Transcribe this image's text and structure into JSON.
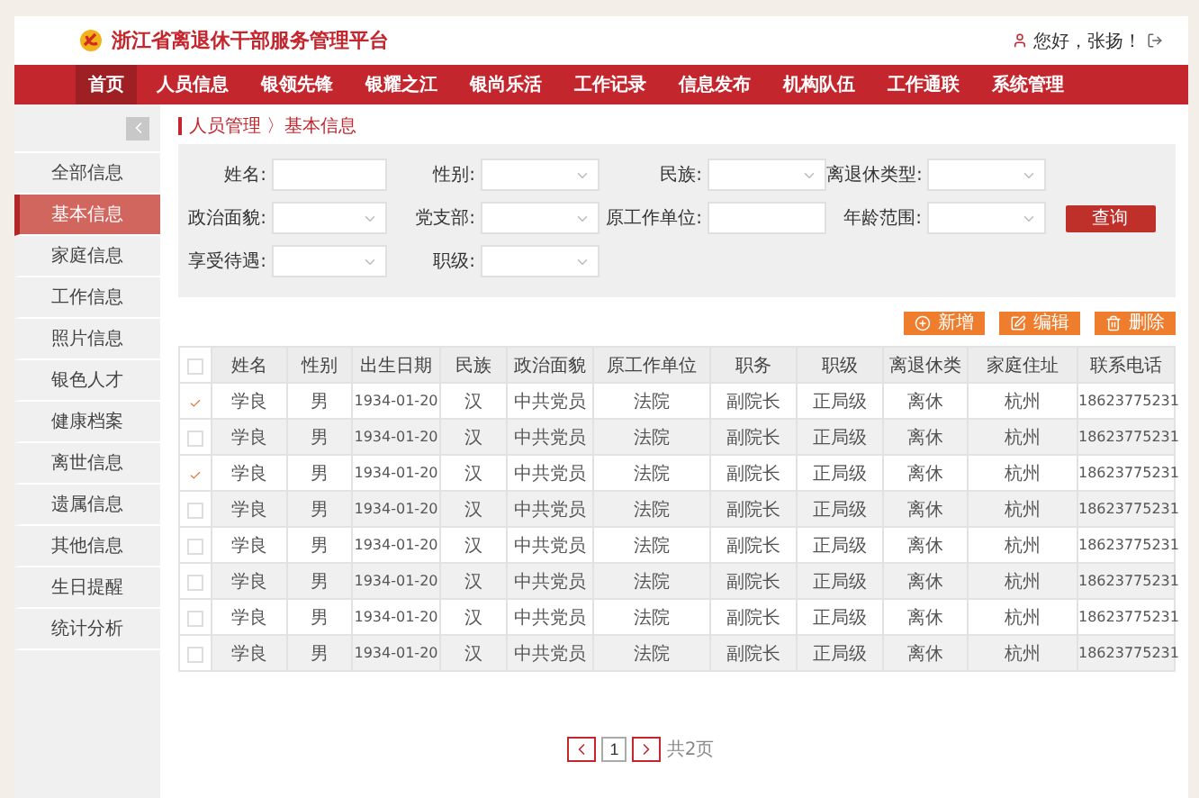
{
  "header": {
    "title": "浙江省离退休干部服务管理平台",
    "greeting": "您好，张扬！"
  },
  "nav": [
    {
      "label": "首页",
      "selected": true
    },
    {
      "label": "人员信息",
      "selected": false
    },
    {
      "label": "银领先锋",
      "selected": false
    },
    {
      "label": "银耀之江",
      "selected": false
    },
    {
      "label": "银尚乐活",
      "selected": false
    },
    {
      "label": "工作记录",
      "selected": false
    },
    {
      "label": "信息发布",
      "selected": false
    },
    {
      "label": "机构队伍",
      "selected": false
    },
    {
      "label": "工作通联",
      "selected": false
    },
    {
      "label": "系统管理",
      "selected": false
    }
  ],
  "sidebar": {
    "items": [
      {
        "label": "全部信息",
        "selected": false
      },
      {
        "label": "基本信息",
        "selected": true
      },
      {
        "label": "家庭信息",
        "selected": false
      },
      {
        "label": "工作信息",
        "selected": false
      },
      {
        "label": "照片信息",
        "selected": false
      },
      {
        "label": "银色人才",
        "selected": false
      },
      {
        "label": "健康档案",
        "selected": false
      },
      {
        "label": "离世信息",
        "selected": false
      },
      {
        "label": "遗属信息",
        "selected": false
      },
      {
        "label": "其他信息",
        "selected": false
      },
      {
        "label": "生日提醒",
        "selected": false
      },
      {
        "label": "统计分析",
        "selected": false
      }
    ]
  },
  "breadcrumb": "人员管理 〉基本信息",
  "filters": [
    {
      "label": "姓名:",
      "kind": "input"
    },
    {
      "label": "性别:",
      "kind": "select"
    },
    {
      "label": "民族:",
      "kind": "select"
    },
    {
      "label": "离退休类型:",
      "kind": "select"
    },
    {
      "label": "政治面貌:",
      "kind": "select"
    },
    {
      "label": "党支部:",
      "kind": "select"
    },
    {
      "label": "原工作单位:",
      "kind": "input"
    },
    {
      "label": "年龄范围:",
      "kind": "select"
    },
    {
      "label": "享受待遇:",
      "kind": "select"
    },
    {
      "label": "职级:",
      "kind": "select"
    }
  ],
  "search_button": "查询",
  "actions": [
    {
      "label": "新增",
      "kind": "add"
    },
    {
      "label": "编辑",
      "kind": "edit"
    },
    {
      "label": "删除",
      "kind": "delete"
    }
  ],
  "table": {
    "header_checked": false,
    "columns": [
      "姓名",
      "性别",
      "出生日期",
      "民族",
      "政治面貌",
      "原工作单位",
      "职务",
      "职级",
      "离退休类",
      "家庭住址",
      "联系电话"
    ],
    "rows": [
      {
        "checked": true,
        "cells": [
          "学良",
          "男",
          "1934-01-20",
          "汉",
          "中共党员",
          "法院",
          "副院长",
          "正局级",
          "离休",
          "杭州",
          "18623775231"
        ]
      },
      {
        "checked": false,
        "cells": [
          "学良",
          "男",
          "1934-01-20",
          "汉",
          "中共党员",
          "法院",
          "副院长",
          "正局级",
          "离休",
          "杭州",
          "18623775231"
        ]
      },
      {
        "checked": true,
        "cells": [
          "学良",
          "男",
          "1934-01-20",
          "汉",
          "中共党员",
          "法院",
          "副院长",
          "正局级",
          "离休",
          "杭州",
          "18623775231"
        ]
      },
      {
        "checked": false,
        "cells": [
          "学良",
          "男",
          "1934-01-20",
          "汉",
          "中共党员",
          "法院",
          "副院长",
          "正局级",
          "离休",
          "杭州",
          "18623775231"
        ]
      },
      {
        "checked": false,
        "cells": [
          "学良",
          "男",
          "1934-01-20",
          "汉",
          "中共党员",
          "法院",
          "副院长",
          "正局级",
          "离休",
          "杭州",
          "18623775231"
        ]
      },
      {
        "checked": false,
        "cells": [
          "学良",
          "男",
          "1934-01-20",
          "汉",
          "中共党员",
          "法院",
          "副院长",
          "正局级",
          "离休",
          "杭州",
          "18623775231"
        ]
      },
      {
        "checked": false,
        "cells": [
          "学良",
          "男",
          "1934-01-20",
          "汉",
          "中共党员",
          "法院",
          "副院长",
          "正局级",
          "离休",
          "杭州",
          "18623775231"
        ]
      },
      {
        "checked": false,
        "cells": [
          "学良",
          "男",
          "1934-01-20",
          "汉",
          "中共党员",
          "法院",
          "副院长",
          "正局级",
          "离休",
          "杭州",
          "18623775231"
        ]
      }
    ]
  },
  "pagination": {
    "page": "1",
    "total": "共2页"
  }
}
